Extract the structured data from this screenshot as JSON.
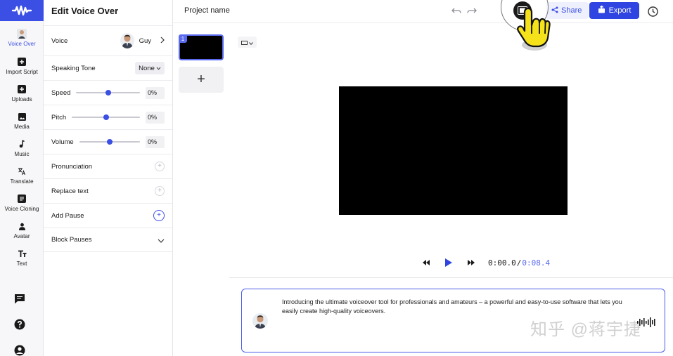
{
  "rail": {
    "items": [
      {
        "label": "Voice Over",
        "icon": "avatar-icon",
        "active": true
      },
      {
        "label": "Import Script",
        "icon": "plus-square-icon"
      },
      {
        "label": "Uploads",
        "icon": "plus-square-icon"
      },
      {
        "label": "Media",
        "icon": "image-icon"
      },
      {
        "label": "Music",
        "icon": "music-note-icon"
      },
      {
        "label": "Translate",
        "icon": "translate-icon"
      },
      {
        "label": "Voice Cloning",
        "icon": "voice-clone-icon"
      },
      {
        "label": "Avatar",
        "icon": "person-icon"
      },
      {
        "label": "Text",
        "icon": "text-icon"
      }
    ],
    "bottom": [
      "chat-icon",
      "help-icon",
      "account-icon"
    ]
  },
  "panel": {
    "title": "Edit Voice Over",
    "voice_label": "Voice",
    "voice_name": "Guy",
    "tone_label": "Speaking Tone",
    "tone_value": "None",
    "speed_label": "Speed",
    "speed_value": "0%",
    "speed_level": 0.5,
    "pitch_label": "Pitch",
    "pitch_value": "0%",
    "pitch_level": 0.5,
    "volume_label": "Volume",
    "volume_value": "0%",
    "volume_level": 0.5,
    "pronunciation_label": "Pronunciation",
    "replace_label": "Replace text",
    "pause_label": "Add Pause",
    "block_label": "Block Pauses"
  },
  "topbar": {
    "project_name": "Project name",
    "share_label": "Share",
    "export_label": "Export"
  },
  "scenes": {
    "items": [
      {
        "number": "1"
      }
    ],
    "add_label": "+"
  },
  "player": {
    "current_time": "0:00.0",
    "separator": "/",
    "total_time": "0:08.4"
  },
  "script": {
    "text": "Introducing the ultimate voiceover tool for professionals and amateurs – a powerful and easy-to-use software that lets you easily create high-quality voiceovers."
  },
  "watermark": "知乎 @蒋宇捷",
  "colors": {
    "accent": "#3b4fe4",
    "export_bg": "#2f44e0",
    "share_bg": "#eef0fd",
    "canvas": "#000000"
  }
}
